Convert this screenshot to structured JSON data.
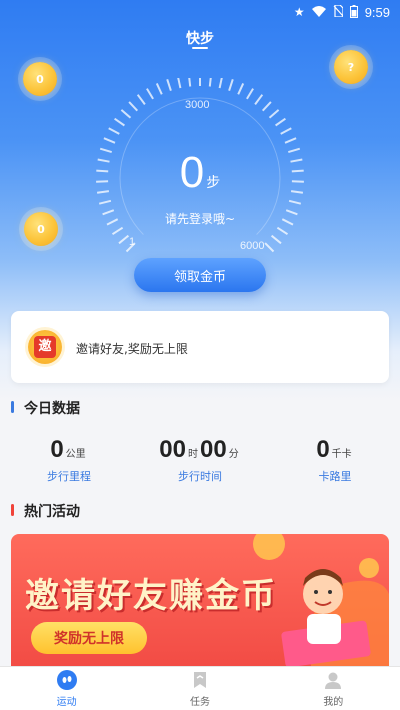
{
  "status_bar": {
    "time": "9:59"
  },
  "header": {
    "title": "快步"
  },
  "coins": {
    "left_top": "0",
    "right_top": "?",
    "left_mid": "0"
  },
  "dial": {
    "top_scale": "3000",
    "left_scale": "1",
    "right_scale": "6000",
    "steps": "0",
    "steps_unit": "步",
    "login_hint": "请先登录哦~"
  },
  "claim_button": {
    "label": "领取金币"
  },
  "invite_card": {
    "badge": "邀",
    "text": "邀请好友,奖励无上限"
  },
  "today": {
    "section_title": "今日数据",
    "distance": {
      "value": "0",
      "unit": "公里",
      "label": "步行里程"
    },
    "time": {
      "hours": "00",
      "hours_unit": "时",
      "minutes": "00",
      "minutes_unit": "分",
      "label": "步行时间"
    },
    "calories": {
      "value": "0",
      "unit": "千卡",
      "label": "卡路里"
    }
  },
  "activities": {
    "section_title": "热门活动",
    "banner_title": "邀请好友赚金币",
    "banner_pill": "奖励无上限"
  },
  "tabbar": {
    "items": [
      {
        "label": "运动",
        "icon": "footprint-icon"
      },
      {
        "label": "任务",
        "icon": "bookmark-icon"
      },
      {
        "label": "我的",
        "icon": "user-icon"
      }
    ]
  },
  "colors": {
    "accent": "#2f7cf2",
    "red_banner": "#f24c45",
    "gold": "#fcc43a"
  }
}
